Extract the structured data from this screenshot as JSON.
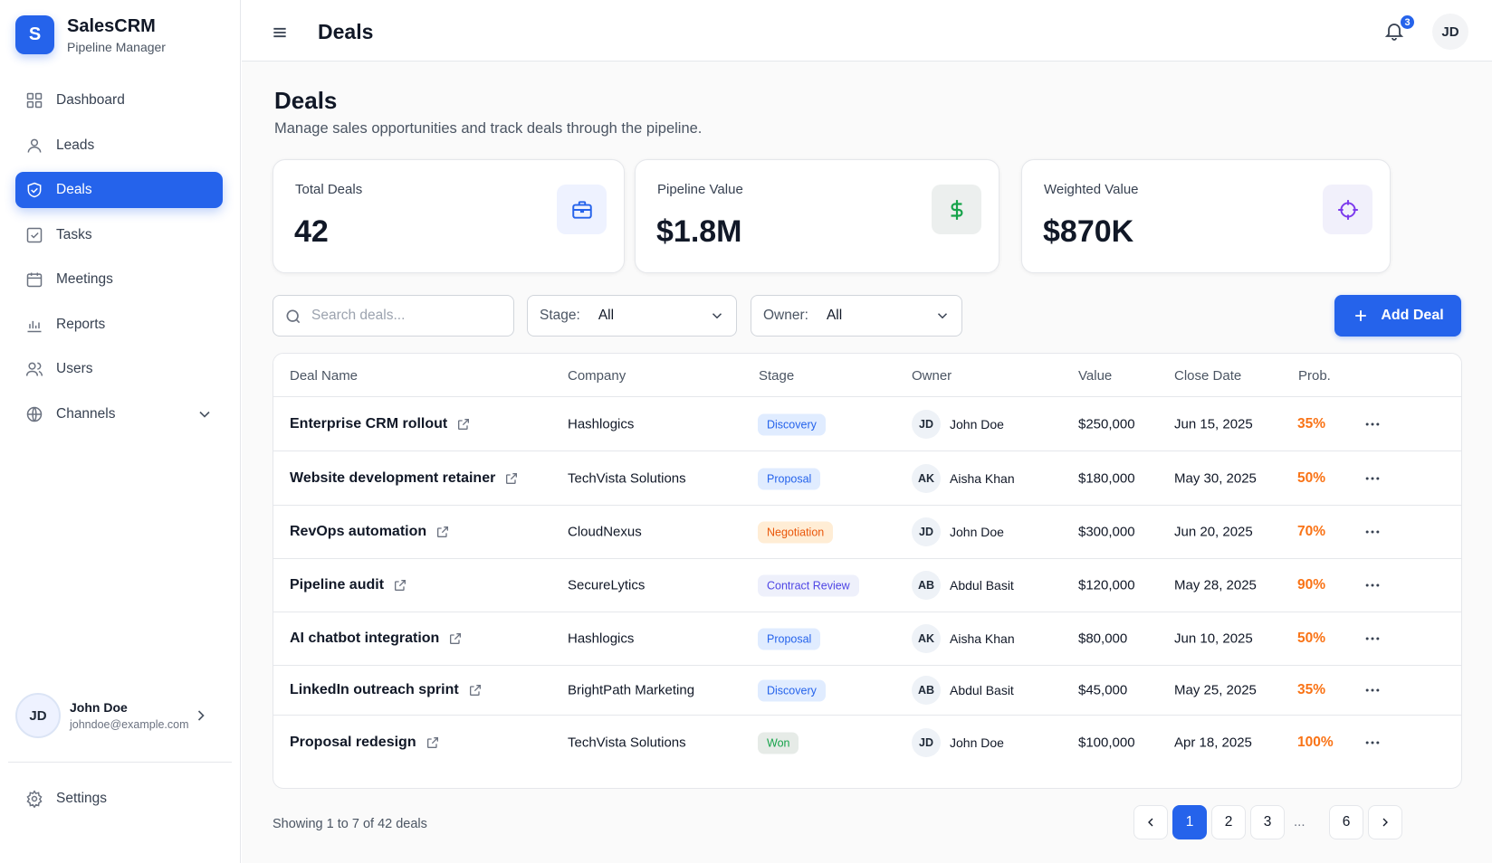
{
  "brand": {
    "logo_letter": "S",
    "title": "SalesCRM",
    "subtitle": "Pipeline Manager"
  },
  "sidebar": {
    "items": [
      {
        "label": "Dashboard",
        "icon": "grid-icon",
        "active": false
      },
      {
        "label": "Leads",
        "icon": "user-icon",
        "active": false
      },
      {
        "label": "Deals",
        "icon": "shield-handshake-icon",
        "active": true
      },
      {
        "label": "Tasks",
        "icon": "checkbox-icon",
        "active": false
      },
      {
        "label": "Meetings",
        "icon": "calendar-icon",
        "active": false
      },
      {
        "label": "Reports",
        "icon": "bar-chart-icon",
        "active": false
      },
      {
        "label": "Users",
        "icon": "users-icon",
        "active": false
      },
      {
        "label": "Channels",
        "icon": "globe-icon",
        "active": false,
        "expandable": true
      }
    ],
    "user": {
      "initials": "JD",
      "name": "John Doe",
      "email": "johndoe@example.com"
    },
    "settings_label": "Settings"
  },
  "topbar": {
    "title": "Deals",
    "notification_count": "3",
    "user_initials": "JD"
  },
  "page": {
    "title": "Deals",
    "description": "Manage sales opportunities and track deals through the pipeline."
  },
  "stats": [
    {
      "label": "Total Deals",
      "value": "42",
      "icon": "briefcase-icon",
      "color": "#2563eb",
      "bg": "#eef2ff"
    },
    {
      "label": "Pipeline Value",
      "value": "$1.8M",
      "icon": "dollar-icon",
      "color": "#16a34a",
      "bg": "#ecefee"
    },
    {
      "label": "Weighted Value",
      "value": "$870K",
      "icon": "target-icon",
      "color": "#7c3aed",
      "bg": "#f1f0fb"
    }
  ],
  "filters": {
    "search_placeholder": "Search deals...",
    "stage_label": "Stage:",
    "stage_value": "All",
    "owner_label": "Owner:",
    "owner_value": "All",
    "add_button": "Add Deal"
  },
  "table": {
    "columns": [
      "Deal Name",
      "Company",
      "Stage",
      "Owner",
      "Value",
      "Close Date",
      "Prob."
    ],
    "rows": [
      {
        "name": "Enterprise CRM rollout",
        "company": "Hashlogics",
        "stage": "Discovery",
        "owner_initials": "JD",
        "owner": "John Doe",
        "value": "$250,000",
        "close": "Jun 15, 2025",
        "prob": "35%"
      },
      {
        "name": "Website development retainer",
        "company": "TechVista Solutions",
        "stage": "Proposal",
        "owner_initials": "AK",
        "owner": "Aisha Khan",
        "value": "$180,000",
        "close": "May 30, 2025",
        "prob": "50%"
      },
      {
        "name": "RevOps automation",
        "company": "CloudNexus",
        "stage": "Negotiation",
        "owner_initials": "JD",
        "owner": "John Doe",
        "value": "$300,000",
        "close": "Jun 20, 2025",
        "prob": "70%"
      },
      {
        "name": "Pipeline audit",
        "company": "SecureLytics",
        "stage": "Contract Review",
        "owner_initials": "AB",
        "owner": "Abdul Basit",
        "value": "$120,000",
        "close": "May 28, 2025",
        "prob": "90%"
      },
      {
        "name": "AI chatbot integration",
        "company": "Hashlogics",
        "stage": "Proposal",
        "owner_initials": "AK",
        "owner": "Aisha Khan",
        "value": "$80,000",
        "close": "Jun 10, 2025",
        "prob": "50%"
      },
      {
        "name": "LinkedIn outreach sprint",
        "company": "BrightPath Marketing",
        "stage": "Discovery",
        "owner_initials": "AB",
        "owner": "Abdul Basit",
        "value": "$45,000",
        "close": "May 25, 2025",
        "prob": "35%"
      },
      {
        "name": "Proposal redesign",
        "company": "TechVista Solutions",
        "stage": "Won",
        "owner_initials": "JD",
        "owner": "John Doe",
        "value": "$100,000",
        "close": "Apr 18, 2025",
        "prob": "100%"
      }
    ]
  },
  "stage_colors": {
    "Discovery": {
      "bg": "#e0ecff",
      "fg": "#2563eb"
    },
    "Proposal": {
      "bg": "#e0ecff",
      "fg": "#2563eb"
    },
    "Negotiation": {
      "bg": "#ffedd5",
      "fg": "#ea580c"
    },
    "Contract Review": {
      "bg": "#eef0fb",
      "fg": "#4f46e5"
    },
    "Won": {
      "bg": "#e6ebe7",
      "fg": "#16a34a"
    }
  },
  "pagination": {
    "showing": "Showing 1 to 7 of 42 deals",
    "pages": [
      "1",
      "2",
      "3"
    ],
    "ellipsis": "...",
    "last": "6",
    "current": "1"
  }
}
